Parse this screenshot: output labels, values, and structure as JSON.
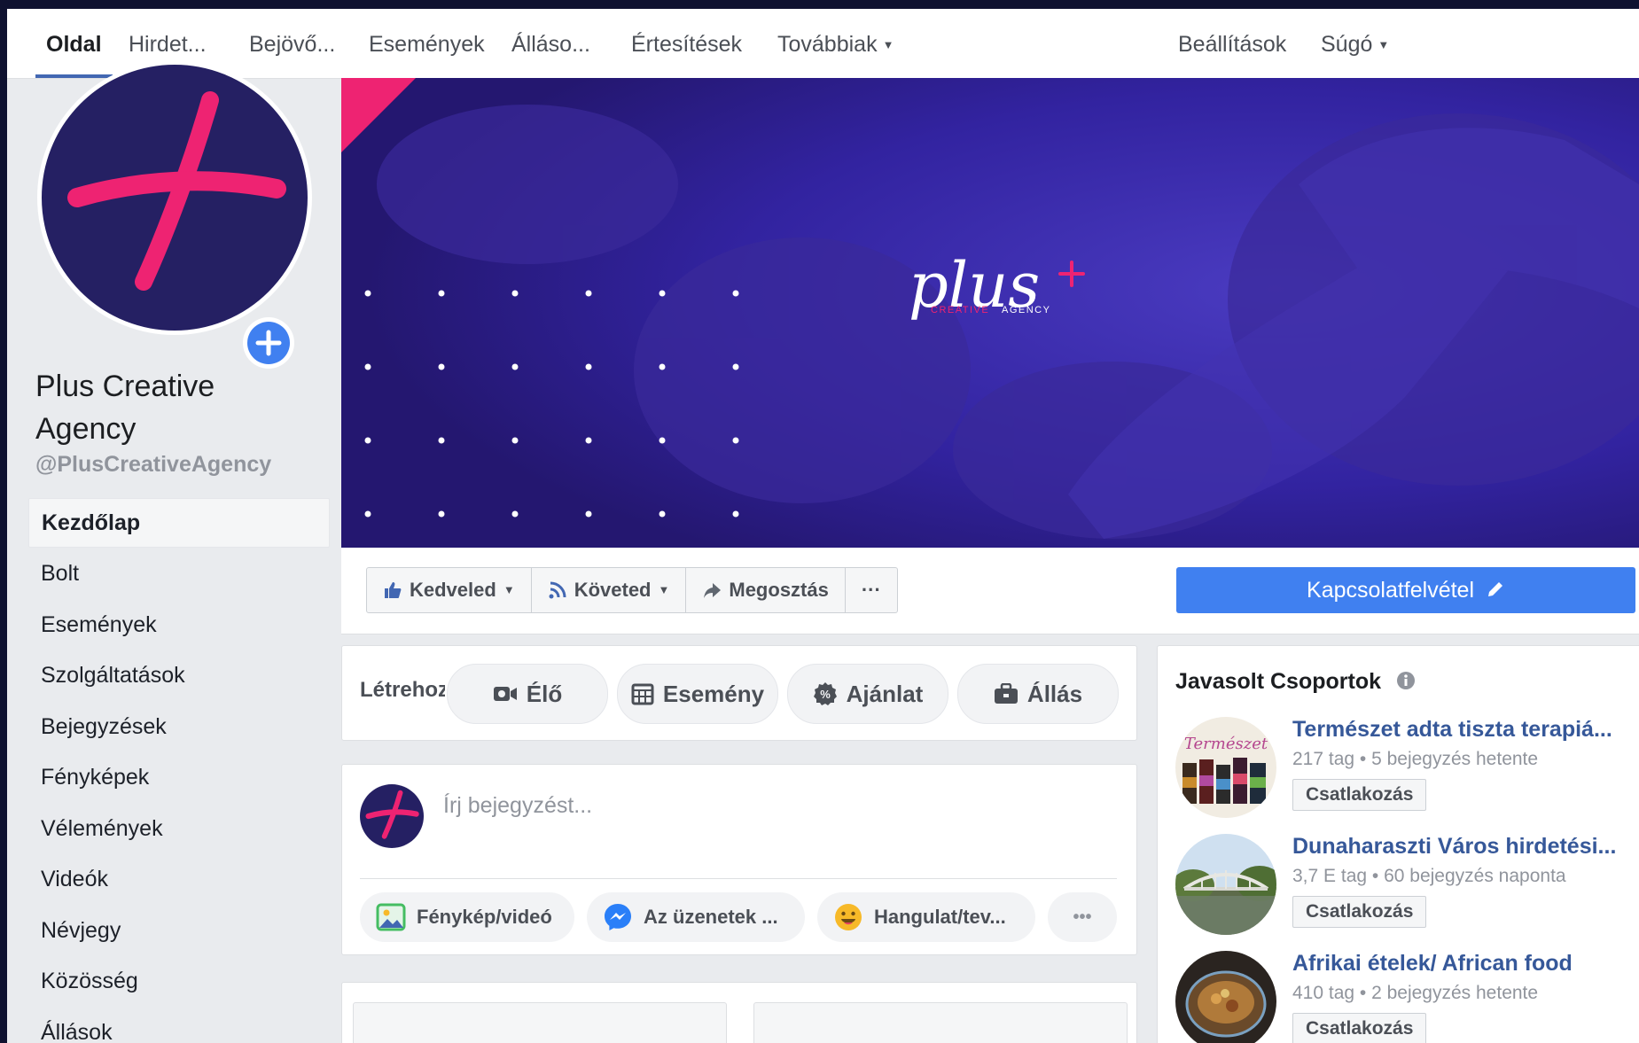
{
  "top_tabs": {
    "oldal": "Oldal",
    "hirdetesek": "Hirdet...",
    "bejovo": "Bejövő...",
    "esemenyek": "Események",
    "allasok": "Álláso...",
    "ertesitesek": "Értesítések",
    "tovabbiak": "Továbbiak",
    "beallitasok": "Beállítások",
    "sugo": "Súgó"
  },
  "page": {
    "name": "Plus Creative Agency",
    "handle": "@PlusCreativeAgency"
  },
  "sidebar": {
    "items": [
      {
        "label": "Kezdőlap"
      },
      {
        "label": "Bolt"
      },
      {
        "label": "Események"
      },
      {
        "label": "Szolgáltatások"
      },
      {
        "label": "Bejegyzések"
      },
      {
        "label": "Fényképek"
      },
      {
        "label": "Vélemények"
      },
      {
        "label": "Videók"
      },
      {
        "label": "Névjegy"
      },
      {
        "label": "Közösség"
      },
      {
        "label": "Állások"
      }
    ]
  },
  "cover": {
    "logo_text": "plus",
    "logo_sub_1": "CREATIVE",
    "logo_sub_2": "AGENCY"
  },
  "actions": {
    "like": "Kedveled",
    "follow": "Követed",
    "share": "Megosztás",
    "more": "···",
    "contact": "Kapcsolatfelvétel"
  },
  "create": {
    "label": "Létrehozás",
    "live": "Élő",
    "event": "Esemény",
    "offer": "Ajánlat",
    "job": "Állás"
  },
  "composer": {
    "placeholder": "Írj bejegyzést...",
    "photo": "Fénykép/videó",
    "messages": "Az üzenetek ...",
    "feeling": "Hangulat/tev...",
    "more": "•••"
  },
  "suggested": {
    "title": "Javasolt Csoportok",
    "groups": [
      {
        "name": "Természet adta tiszta terapiá...",
        "meta": "217 tag • 5 bejegyzés hetente",
        "join": "Csatlakozás",
        "thumb_text": "Természet"
      },
      {
        "name": "Dunaharaszti Város hirdetési...",
        "meta": "3,7 E tag • 60 bejegyzés naponta",
        "join": "Csatlakozás"
      },
      {
        "name": "Afrikai ételek/ African food",
        "meta": "410 tag • 2 bejegyzés hetente",
        "join": "Csatlakozás"
      }
    ]
  },
  "colors": {
    "brand_navy": "#252063",
    "brand_pink": "#ee2372",
    "fb_blue": "#4080f0",
    "link_blue": "#365899",
    "cover_purple": "#2e1f8a"
  }
}
